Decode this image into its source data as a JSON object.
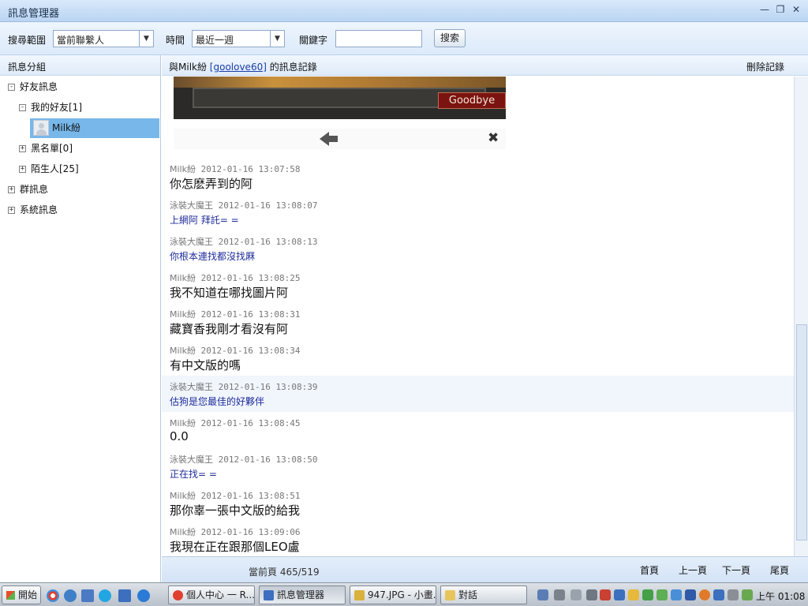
{
  "window": {
    "title": "訊息管理器"
  },
  "toolbar": {
    "scope_label": "搜尋範圍",
    "scope_value": "當前聯繫人",
    "time_label": "時間",
    "time_value": "最近一週",
    "keyword_label": "關鍵字",
    "keyword_value": "",
    "search_button": "搜索"
  },
  "sidebar": {
    "header": "訊息分組",
    "tree": {
      "friends": "好友訊息",
      "my_friends": "我的好友[1]",
      "selected_contact": "Milk紛",
      "blacklist": "黑名單[0]",
      "strangers": "陌生人[25]",
      "groups": "群訊息",
      "system": "系統訊息"
    }
  },
  "conversation": {
    "prefix": "與Milk紛 ",
    "account": "[goolove60]",
    "suffix": " 的訊息記錄",
    "delete": "刪除記錄"
  },
  "preview": {
    "button_text": "Goodbye"
  },
  "messages": [
    {
      "sender": "Milk紛",
      "time": "2012-01-16 13:07:58",
      "text": "你怎麽弄到的阿"
    },
    {
      "sender": "泳裝大魔王",
      "time": "2012-01-16 13:08:07",
      "text": "上網阿  拜託= ="
    },
    {
      "sender": "泳裝大魔王",
      "time": "2012-01-16 13:08:13",
      "text": "你根本連找都沒找厤"
    },
    {
      "sender": "Milk紛",
      "time": "2012-01-16 13:08:25",
      "text": "我不知道在哪找圖片阿"
    },
    {
      "sender": "Milk紛",
      "time": "2012-01-16 13:08:31",
      "text": "藏寶香我剛才看沒有阿"
    },
    {
      "sender": "Milk紛",
      "time": "2012-01-16 13:08:34",
      "text": "有中文版的嗎"
    },
    {
      "sender": "泳裝大魔王",
      "time": "2012-01-16 13:08:39",
      "text": "估狗是您最佳的好夥伴"
    },
    {
      "sender": "Milk紛",
      "time": "2012-01-16 13:08:45",
      "text": "0.0"
    },
    {
      "sender": "泳裝大魔王",
      "time": "2012-01-16 13:08:50",
      "text": "正在找= ="
    },
    {
      "sender": "Milk紛",
      "time": "2012-01-16 13:08:51",
      "text": "那你辜一張中文版的給我"
    },
    {
      "sender": "Milk紛",
      "time": "2012-01-16 13:09:06",
      "text": "我現在正在跟那個LEO盧"
    }
  ],
  "footer": {
    "current_page": "當前頁 465/519",
    "first": "首頁",
    "prev": "上一頁",
    "next": "下一頁",
    "last": "尾頁"
  },
  "taskbar": {
    "start": "開始",
    "tasks": [
      "個人中心 一 R...",
      "訊息管理器",
      "947.JPG - 小畫...",
      "對話"
    ],
    "clock": "上午 01:08"
  }
}
